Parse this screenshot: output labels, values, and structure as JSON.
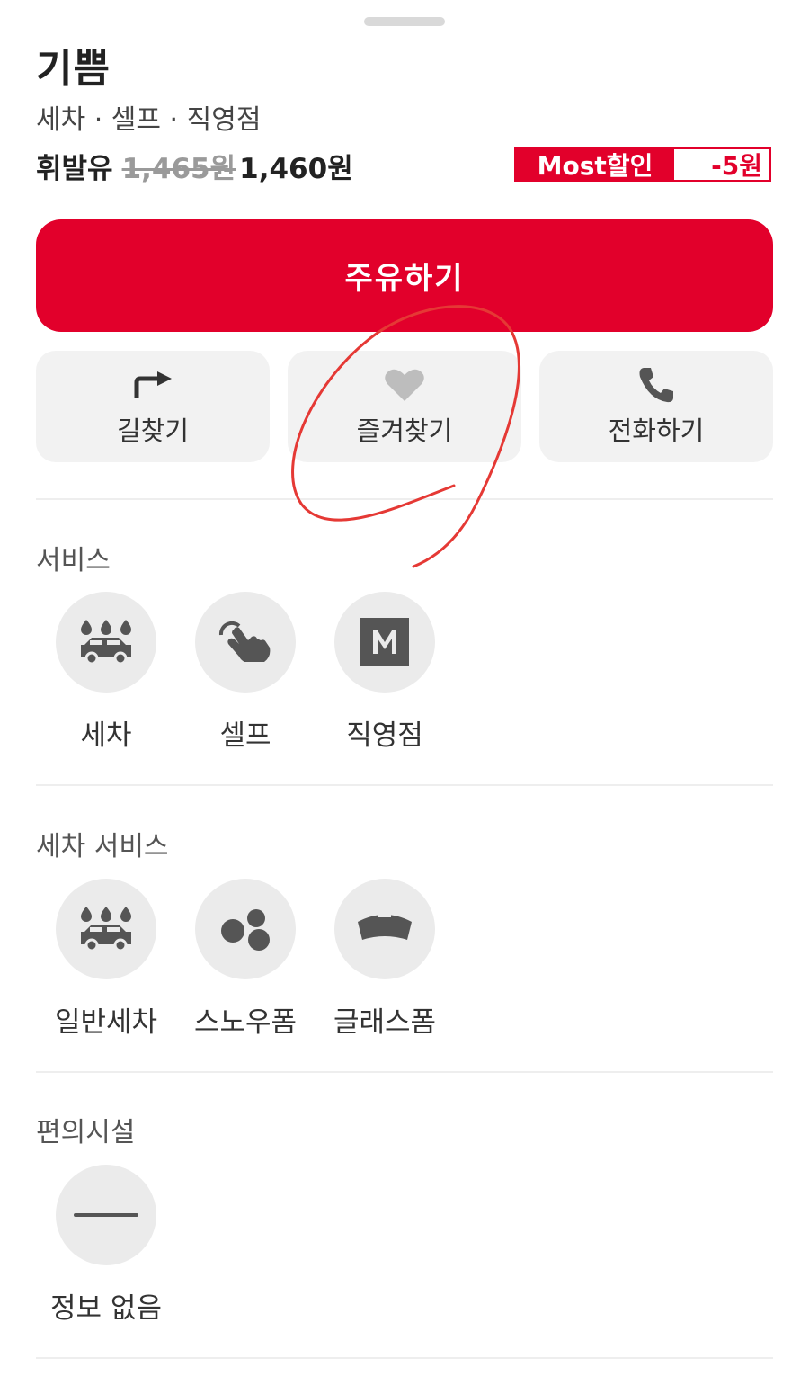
{
  "station": {
    "name": "기쁨",
    "tags": "세차 · 셀프 · 직영점",
    "fuel_type": "휘발유",
    "old_price": "1,465원",
    "new_price": "1,460원",
    "badge_label": "Most할인",
    "badge_value": "-5원"
  },
  "colors": {
    "accent": "#e2002b",
    "icon": "#555555",
    "favorite_icon": "#bdbdbd",
    "annotation": "#e53935"
  },
  "primary_button": {
    "label": "주유하기"
  },
  "actions": [
    {
      "label": "길찾기",
      "icon": "turn-right-arrow-icon"
    },
    {
      "label": "즐겨찾기",
      "icon": "heart-icon"
    },
    {
      "label": "전화하기",
      "icon": "phone-icon"
    }
  ],
  "sections": {
    "services": {
      "title": "서비스",
      "items": [
        {
          "label": "세차",
          "icon": "car-wash-icon"
        },
        {
          "label": "셀프",
          "icon": "touch-hand-icon"
        },
        {
          "label": "직영점",
          "icon": "m-logo-icon"
        }
      ]
    },
    "carwash": {
      "title": "세차 서비스",
      "items": [
        {
          "label": "일반세차",
          "icon": "car-wash-icon"
        },
        {
          "label": "스노우폼",
          "icon": "bubbles-icon"
        },
        {
          "label": "글래스폼",
          "icon": "windshield-icon"
        }
      ]
    },
    "amenities": {
      "title": "편의시설",
      "items": [
        {
          "label": "정보 없음",
          "icon": "dash-icon"
        }
      ]
    }
  }
}
